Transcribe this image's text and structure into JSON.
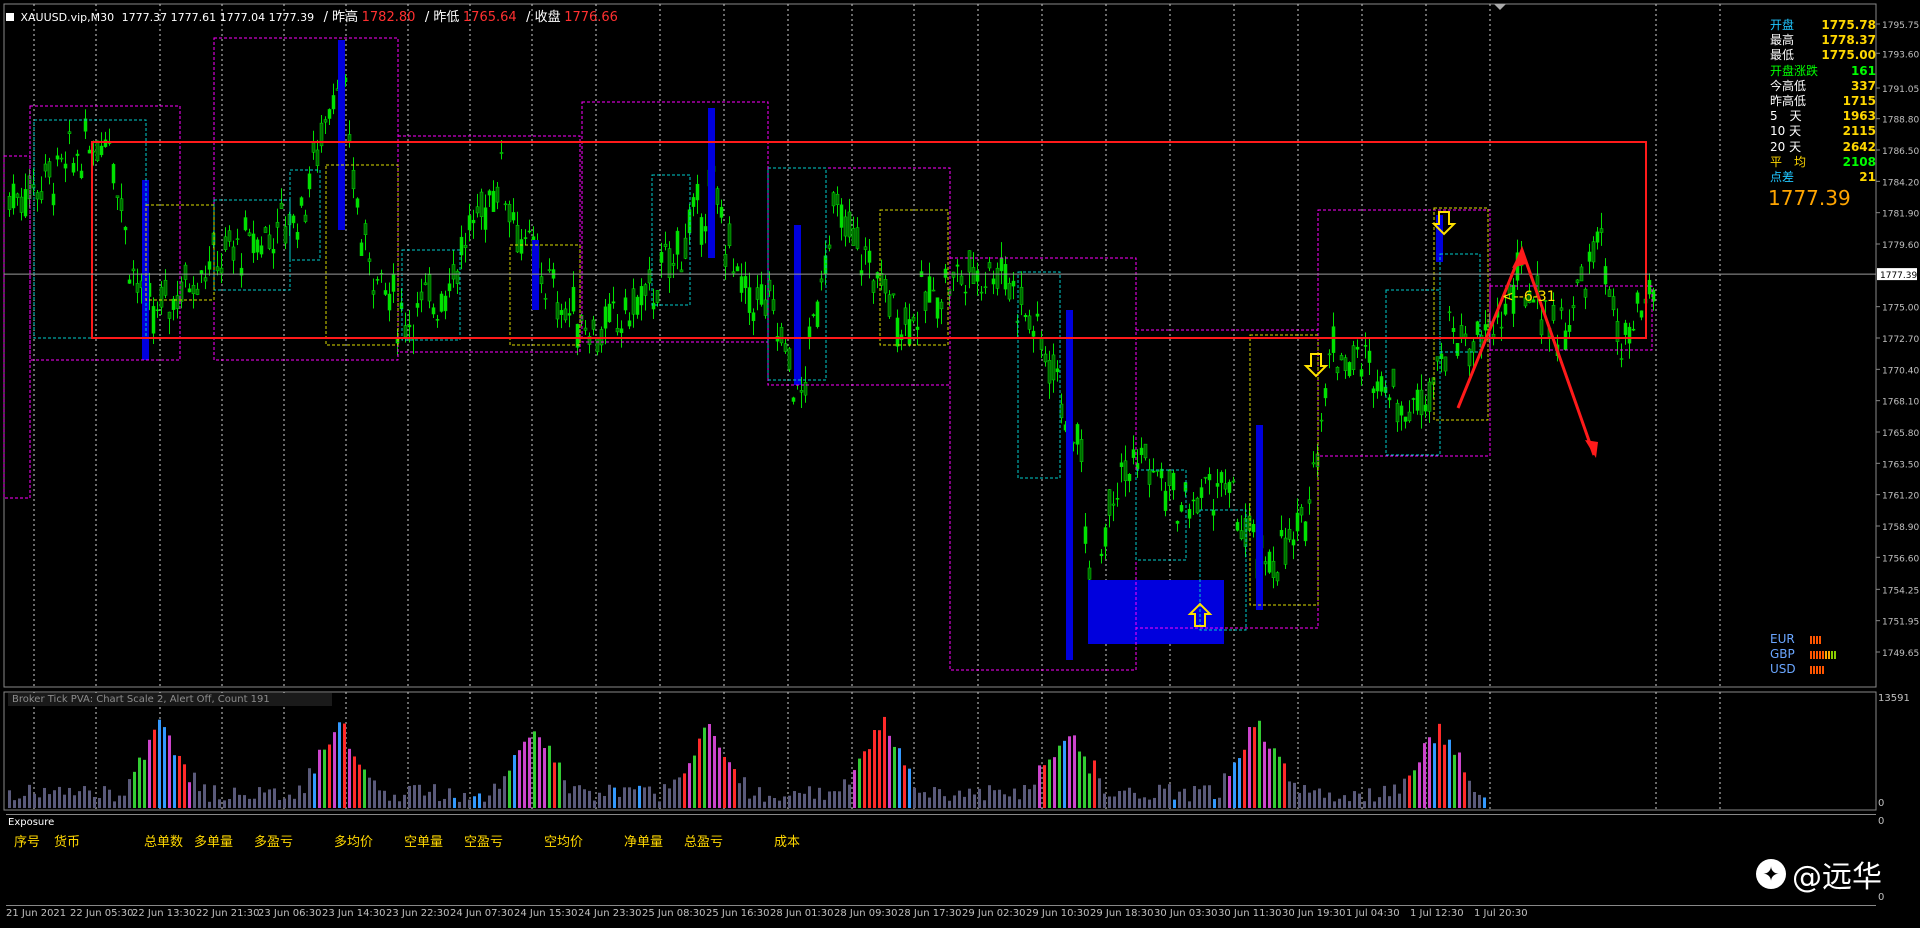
{
  "header": {
    "symbol": "XAUUSD.vip,M30",
    "ohlc": "1777.37 1777.61 1777.04 1777.39",
    "prev_high_label": "/ 昨高",
    "prev_high": "1782.80",
    "prev_low_label": "/ 昨低",
    "prev_low": "1765.64",
    "close_label": "/ 收盘",
    "close": "1776.66"
  },
  "info_panel": [
    {
      "label": "开盘",
      "value": "1775.78",
      "label_color": "#1fc6ff",
      "value_color": "#ffd700"
    },
    {
      "label": "最高",
      "value": "1778.37",
      "label_color": "#ffffff",
      "value_color": "#ffd700"
    },
    {
      "label": "最低",
      "value": "1775.00",
      "label_color": "#ffffff",
      "value_color": "#ffd700"
    },
    {
      "label": "开盘涨跌",
      "value": "161",
      "label_color": "#00ff00",
      "value_color": "#00ff00"
    },
    {
      "label": "今高低",
      "value": "337",
      "label_color": "#ffffff",
      "value_color": "#ffd700"
    },
    {
      "label": "昨高低",
      "value": "1715",
      "label_color": "#ffffff",
      "value_color": "#ffd700"
    },
    {
      "label": "5　天",
      "value": "1963",
      "label_color": "#ffffff",
      "value_color": "#ffd700"
    },
    {
      "label": "10 天",
      "value": "2115",
      "label_color": "#ffffff",
      "value_color": "#ffd700"
    },
    {
      "label": "20 天",
      "value": "2642",
      "label_color": "#ffffff",
      "value_color": "#ffd700"
    },
    {
      "label": "平　均",
      "value": "2108",
      "label_color": "#ffd700",
      "value_color": "#00ff00"
    },
    {
      "label": "点差",
      "value": "21",
      "label_color": "#1fc6ff",
      "value_color": "#ffd700"
    }
  ],
  "current_price": "1777.39",
  "current_price_tag": "1777.39",
  "price_axis": [
    "1795.75",
    "1793.60",
    "1791.05",
    "1788.80",
    "1786.50",
    "1784.20",
    "1781.90",
    "1779.60",
    "1775.00",
    "1772.70",
    "1770.40",
    "1768.10",
    "1765.80",
    "1763.50",
    "1761.20",
    "1758.90",
    "1756.60",
    "1754.25",
    "1751.95",
    "1749.65"
  ],
  "annotation": "<--6-31",
  "currencies": [
    {
      "name": "EUR",
      "bars": [
        "#ff5500",
        "#ff5500",
        "#ff5500",
        "#ff5500"
      ]
    },
    {
      "name": "GBP",
      "bars": [
        "#ff5500",
        "#ff5500",
        "#ff5500",
        "#ff5500",
        "#ff5500",
        "#ffaa00",
        "#ffaa00",
        "#88cc00",
        "#88cc00"
      ]
    },
    {
      "name": "USD",
      "bars": [
        "#ff5500",
        "#ff5500",
        "#ff5500",
        "#ff5500",
        "#ff5500"
      ]
    }
  ],
  "volume": {
    "title": "Broker Tick PVA:   Chart Scale  2,  Alert Off,  Count  191",
    "scale_top": "13591",
    "scale_bottom": "0"
  },
  "exposure": {
    "title": "Exposure",
    "columns": [
      "序号",
      "货币",
      "总单数",
      "多单量",
      "多盈亏",
      "多均价",
      "空单量",
      "空盈亏",
      "空均价",
      "净单量",
      "总盈亏",
      "成本"
    ],
    "scale_top": "0",
    "scale_bottom": "0"
  },
  "time_axis": [
    "21 Jun 2021",
    "22 Jun 05:30",
    "22 Jun 13:30",
    "22 Jun 21:30",
    "23 Jun 06:30",
    "23 Jun 14:30",
    "23 Jun 22:30",
    "24 Jun 07:30",
    "24 Jun 15:30",
    "24 Jun 23:30",
    "25 Jun 08:30",
    "25 Jun 16:30",
    "28 Jun 01:30",
    "28 Jun 09:30",
    "28 Jun 17:30",
    "29 Jun 02:30",
    "29 Jun 10:30",
    "29 Jun 18:30",
    "30 Jun 03:30",
    "30 Jun 11:30",
    "30 Jun 19:30",
    "1 Jul 04:30",
    "1 Jul 12:30",
    "1 Jul 20:30"
  ],
  "watermark": "@远华",
  "colors": {
    "bull": "#00e000",
    "bear": "#00ff00",
    "box_magenta": "#ff00ff",
    "box_cyan": "#00cccc",
    "box_yellow": "#dddd00",
    "red": "#ff1a1a",
    "blue": "#0000dd",
    "arrow": "#ffe100"
  }
}
